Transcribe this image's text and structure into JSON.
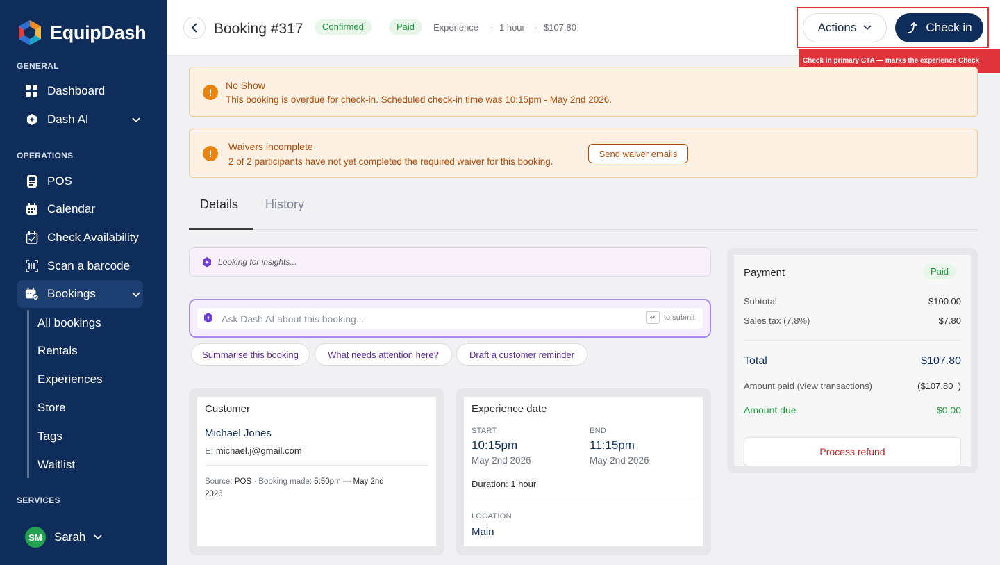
{
  "brand": {
    "name": "EquipDash"
  },
  "sidebar": {
    "sections": [
      "GENERAL",
      "OPERATIONS",
      "SERVICES"
    ],
    "general": [
      {
        "label": "Dashboard",
        "icon": "grid-icon"
      },
      {
        "label": "Dash AI",
        "icon": "hexagon-ai-icon"
      }
    ],
    "operations": [
      {
        "label": "POS",
        "icon": "pos-terminal-icon"
      },
      {
        "label": "Calendar",
        "icon": "calendar-icon"
      },
      {
        "label": "Check Availability",
        "icon": "calendar-check-icon"
      },
      {
        "label": "Scan a barcode",
        "icon": "barcode-scan-icon"
      },
      {
        "label": "Bookings",
        "icon": "bookings-icon"
      }
    ],
    "bookings_sub": [
      "All bookings",
      "Rentals",
      "Experiences",
      "Store",
      "Tags",
      "Waitlist"
    ],
    "user": {
      "initials": "SM",
      "name": "Sarah"
    }
  },
  "header": {
    "title": "Booking #317",
    "status": "Confirmed",
    "payment_status": "Paid",
    "type": "Experience",
    "sep": "·",
    "duration": "1 hour",
    "price": "$107.80",
    "actions_label": "Actions",
    "checkin_label": "Check in",
    "tooltip": "Check in primary CTA — marks the experience Check"
  },
  "alerts": {
    "noshow": {
      "title": "No Show",
      "text": "This booking is overdue for check-in. Scheduled check-in time was 10:15pm - May 2nd 2026."
    },
    "waivers": {
      "title": "Waivers incomplete",
      "text": "2 of 2 participants have not yet completed the required waiver for this booking.",
      "button": "Send waiver emails"
    }
  },
  "tabs": [
    "Details",
    "History"
  ],
  "ai": {
    "insight_text": "Looking for insights...",
    "ask_placeholder": "Ask Dash AI about this booking...",
    "enter_key": "↵",
    "submit_hint": "to submit",
    "chips": [
      "Summarise this booking",
      "What needs attention here?",
      "Draft a customer reminder"
    ]
  },
  "customer": {
    "title": "Customer",
    "name": "Michael Jones",
    "email_label": "E:",
    "email": "michael.j@gmail.com",
    "source_label": "Source:",
    "source": "POS",
    "made_label": "Booking made:",
    "made_time": "5:50pm — May 2nd",
    "made_year": "2026"
  },
  "experience": {
    "title": "Experience date",
    "start_label": "START",
    "start_time": "10:15pm",
    "start_date": "May 2nd 2026",
    "end_label": "END",
    "end_time": "11:15pm",
    "end_date": "May 2nd 2026",
    "duration_label": "Duration: 1 hour",
    "location_label": "LOCATION",
    "location": "Main"
  },
  "payment": {
    "title": "Payment",
    "badge": "Paid",
    "subtotal_label": "Subtotal",
    "subtotal": "$100.00",
    "tax_label": "Sales tax (7.8%)",
    "tax": "$7.80",
    "total_label": "Total",
    "total": "$107.80",
    "paid_label": "Amount paid (view transactions)",
    "paid": "($107.80  )",
    "due_label": "Amount due",
    "due": "$0.00",
    "refund_label": "Process refund"
  },
  "colors": {
    "sidebar": "#0e2d5a",
    "primary": "#0e2d5a",
    "alert_bg": "#fdf1e4",
    "success": "#1f9a3e",
    "danger": "#c91f27",
    "ai_purple": "#6d3fd1"
  }
}
